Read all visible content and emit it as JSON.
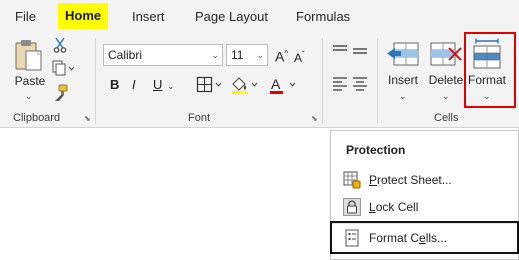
{
  "tabs": {
    "file": "File",
    "home": "Home",
    "insert": "Insert",
    "page_layout": "Page Layout",
    "formulas": "Formulas"
  },
  "clipboard": {
    "paste_label": "Paste",
    "group_label": "Clipboard"
  },
  "font": {
    "font_name": "Calibri",
    "font_size": "11",
    "group_label": "Font",
    "bold_label": "B",
    "italic_label": "I",
    "underline_label": "U",
    "grow_label": "A",
    "shrink_label": "A"
  },
  "cells": {
    "insert_label": "Insert",
    "delete_label": "Delete",
    "format_label": "Format",
    "group_label": "Cells"
  },
  "menu": {
    "section_title": "Protection",
    "protect_sheet_underlined": "P",
    "protect_sheet_rest": "rotect Sheet...",
    "lock_cell_underlined": "L",
    "lock_cell_rest": "ock Cell",
    "format_cells_prefix": "Format C",
    "format_cells_underlined": "e",
    "format_cells_suffix": "lls..."
  },
  "colors": {
    "tab_highlight": "#ffff00",
    "format_outline": "#e00000",
    "ribbon_bg": "#f3f3f3",
    "cells_icon_blue": "#2e75b6"
  }
}
